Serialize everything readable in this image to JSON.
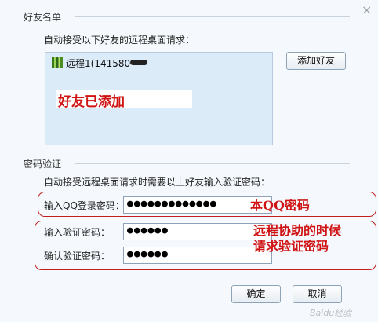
{
  "window": {
    "close_glyph": "×"
  },
  "friends_section": {
    "title": "好友名单",
    "description": "自动接受以下好友的远程桌面请求：",
    "friends": [
      {
        "name": "远程1(141580"
      }
    ],
    "add_button": "添加好友",
    "annotation": "好友已添加"
  },
  "password_section": {
    "title": "密码验证",
    "description": "自动接受远程桌面请求时需要以上好友输入验证密码：",
    "qq_password": {
      "label": "输入QQ登录密码：",
      "value": "●●●●●●●●●●●●●"
    },
    "verify_password": {
      "label": "输入验证密码：",
      "value": "●●●●●●"
    },
    "confirm_password": {
      "label": "确认验证密码：",
      "value": "●●●●●●"
    },
    "annotation_qq": "本QQ密码",
    "annotation_verify_line1": "远程协助的时候",
    "annotation_verify_line2": "请求验证密码"
  },
  "footer": {
    "ok_button": "确定",
    "cancel_button": "取消",
    "watermark": "Baidu经验"
  },
  "colors": {
    "annotation_red": "#d01414",
    "frame_red": "#c21e1e",
    "friend_box_bg": "#dcebf8"
  }
}
